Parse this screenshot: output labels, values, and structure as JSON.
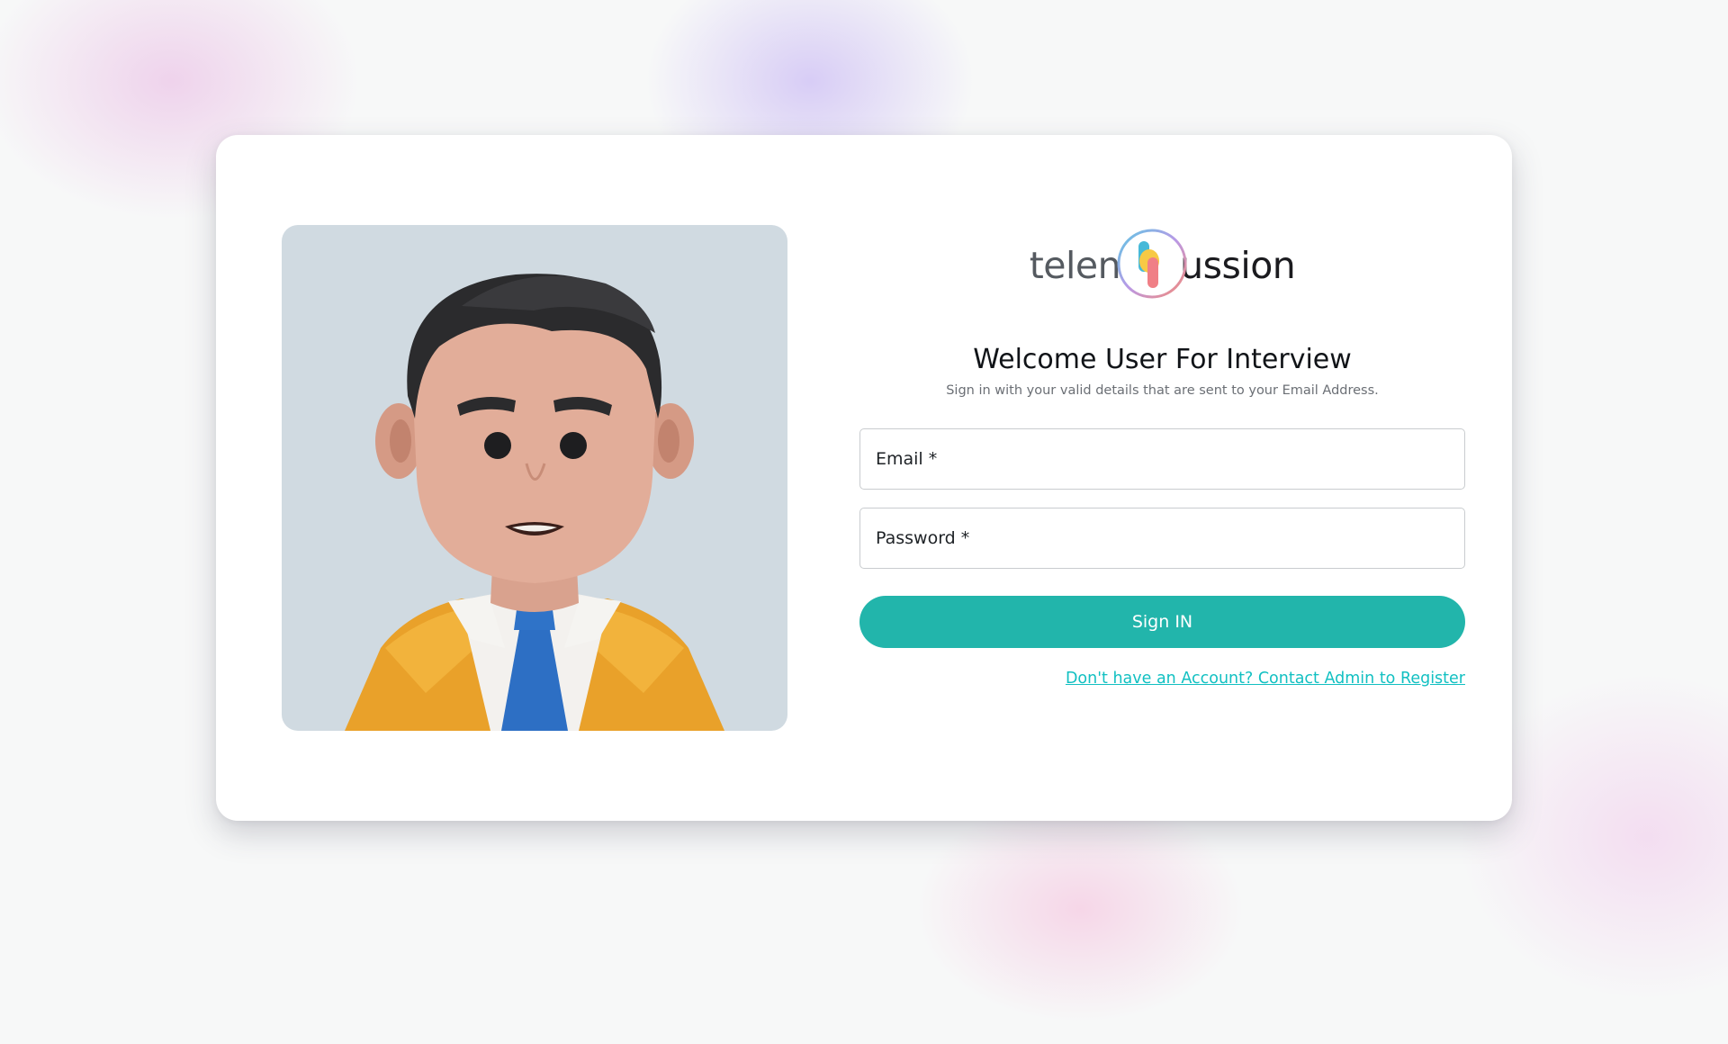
{
  "logo": {
    "text_left": "telen",
    "text_right": "ussion"
  },
  "heading": {
    "title": "Welcome User For Interview",
    "subtitle": "Sign in with your valid details that are sent to your Email Address."
  },
  "form": {
    "email_label": "Email *",
    "password_label": "Password *",
    "submit_label": "Sign IN",
    "register_link": "Don't have an Account? Contact Admin to Register"
  },
  "colors": {
    "accent": "#22b5ab",
    "link": "#12c0c2",
    "avatar_bg": "#d0dae1"
  },
  "icons": {
    "avatar": "cartoon-man-avatar-illustration",
    "logo_mark": "circle-rainbow-logo-mark"
  }
}
